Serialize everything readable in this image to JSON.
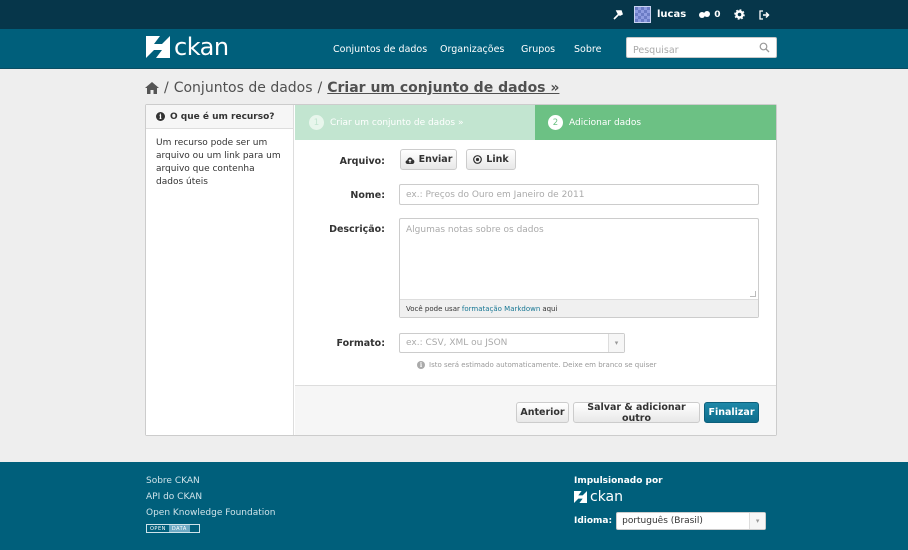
{
  "topbar": {
    "user_name": "lucas",
    "activity_count": "0"
  },
  "site": {
    "logo_text": "ckan",
    "brand_color": "#005f7b"
  },
  "nav": {
    "items": [
      "Conjuntos de dados",
      "Organizações",
      "Grupos",
      "Sobre"
    ]
  },
  "search": {
    "placeholder": "Pesquisar"
  },
  "breadcrumb": {
    "items": [
      "Conjuntos de dados",
      "Criar um conjunto de dados »"
    ]
  },
  "aside": {
    "title": "O que é um recurso?",
    "body": "Um recurso pode ser um arquivo ou um link para um arquivo que contenha dados úteis"
  },
  "stages": [
    {
      "number": "1",
      "label": "Criar um conjunto de dados »"
    },
    {
      "number": "2",
      "label": "Adicionar dados"
    }
  ],
  "form": {
    "arquivo_label": "Arquivo:",
    "upload_button": "Enviar",
    "link_button": "Link",
    "nome_label": "Nome:",
    "nome_placeholder": "ex.: Preços do Ouro em Janeiro de 2011",
    "descricao_label": "Descrição:",
    "descricao_placeholder": "Algumas notas sobre os dados",
    "markdown_prefix": "Você pode usar",
    "markdown_link": "formatação Markdown",
    "markdown_suffix": "aqui",
    "formato_label": "Formato:",
    "formato_placeholder": "ex.: CSV, XML ou JSON",
    "formato_hint": "Isto será estimado automaticamente. Deixe em branco se quiser"
  },
  "actions": {
    "previous": "Anterior",
    "save_add": "Salvar & adicionar outro",
    "finish": "Finalizar"
  },
  "footer": {
    "links": [
      "Sobre CKAN",
      "API do CKAN",
      "Open Knowledge Foundation"
    ],
    "badge_open": "OPEN",
    "badge_data": "DATA",
    "powered_by": "Impulsionado por",
    "powered_logo": "ckan",
    "language_label": "Idioma:",
    "language_value": "português (Brasil)"
  }
}
